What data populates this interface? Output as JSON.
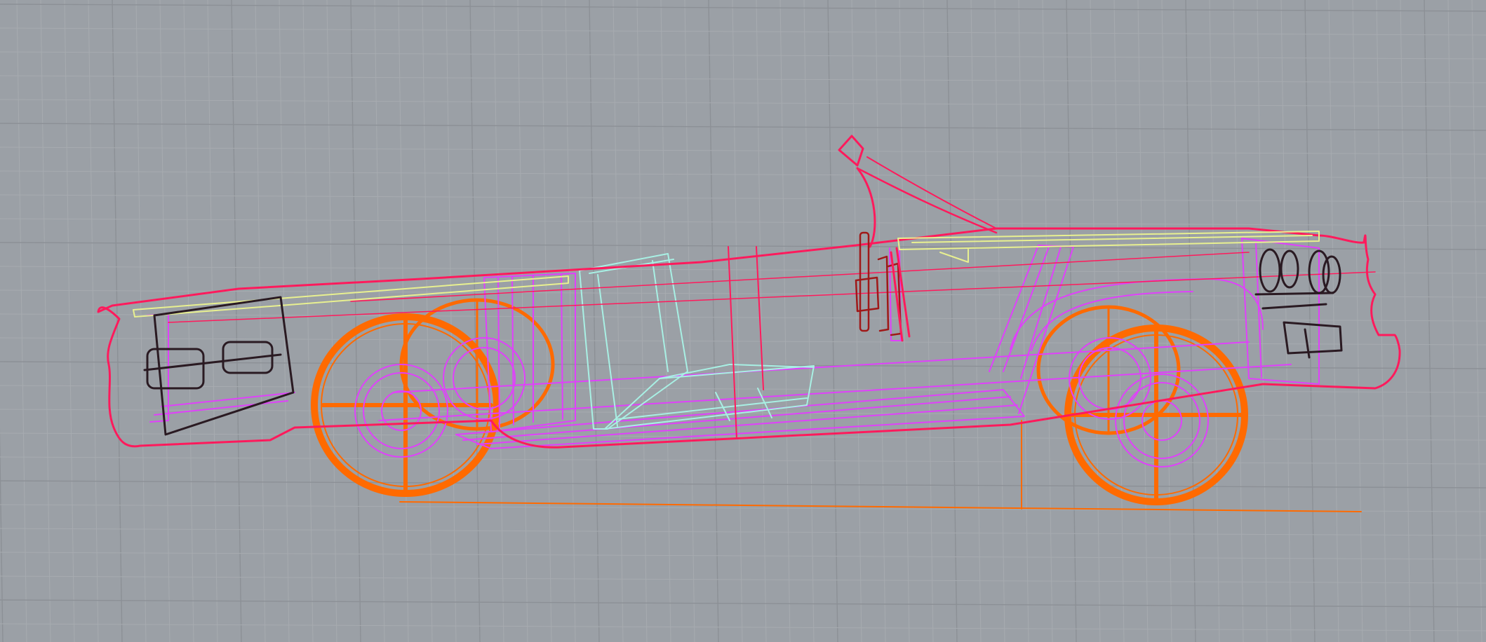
{
  "viewport": {
    "label": "",
    "background": "#9ba0a6",
    "grid_minor_color": "#a7abb0",
    "grid_major_color": "#8c9096"
  },
  "layers": [
    {
      "name": "body-outline",
      "color": "#ff1a5c"
    },
    {
      "name": "frame",
      "color": "#e040fb"
    },
    {
      "name": "wheels",
      "color": "#ff6a00"
    },
    {
      "name": "seats",
      "color": "#a8f0e4"
    },
    {
      "name": "trim",
      "color": "#e8f090"
    },
    {
      "name": "hardware",
      "color": "#2a1a22"
    },
    {
      "name": "steering",
      "color": "#a01818"
    }
  ],
  "model": {
    "object": "convertible-car-wireframe",
    "view": "perspective"
  }
}
